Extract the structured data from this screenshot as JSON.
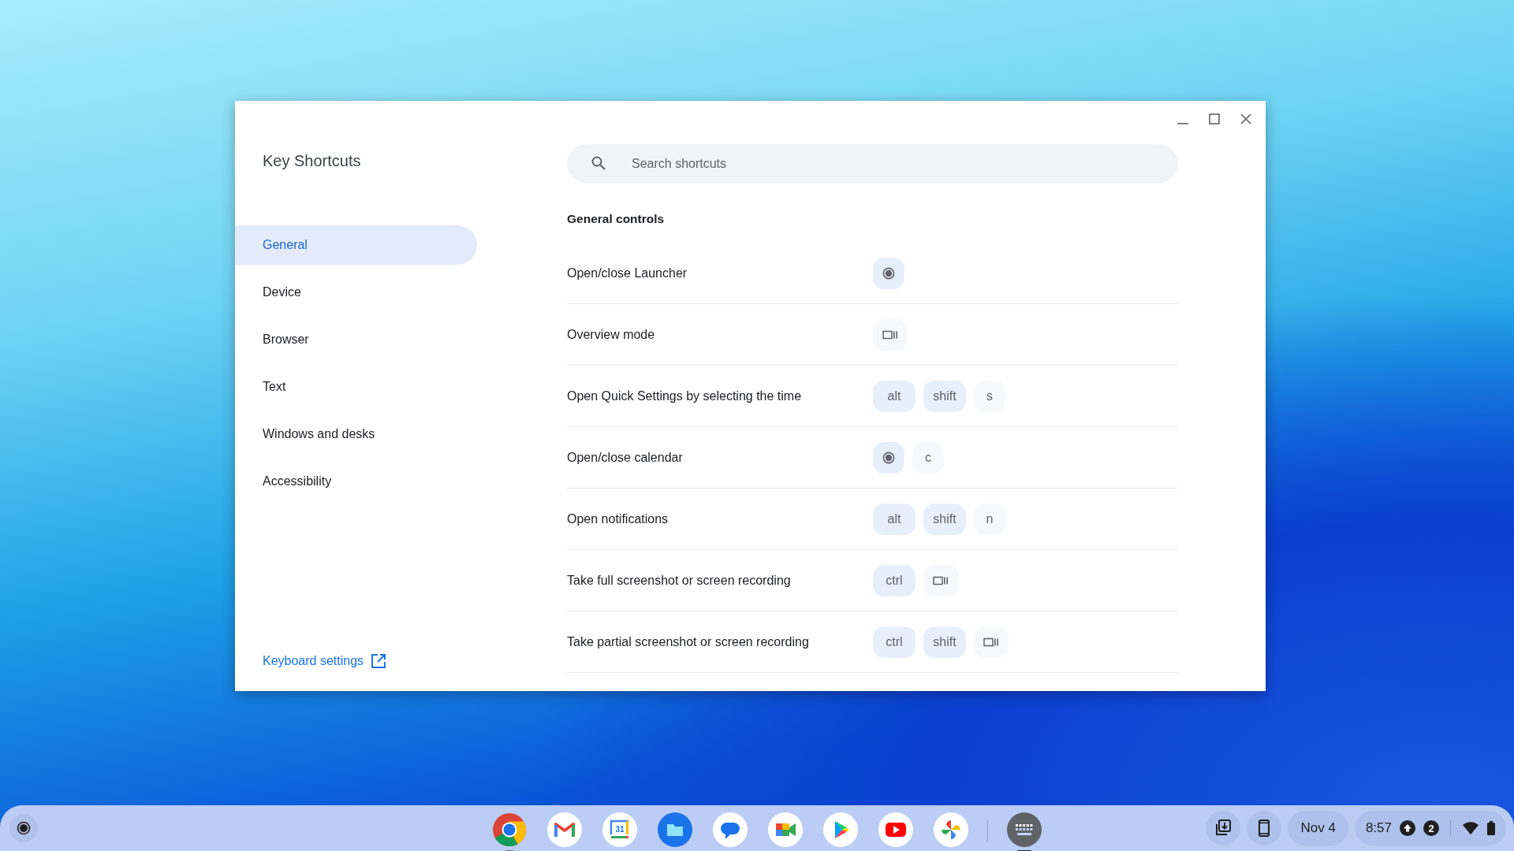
{
  "window": {
    "title": "Key Shortcuts"
  },
  "sidebar": {
    "items": [
      {
        "label": "General",
        "selected": true
      },
      {
        "label": "Device",
        "selected": false
      },
      {
        "label": "Browser",
        "selected": false
      },
      {
        "label": "Text",
        "selected": false
      },
      {
        "label": "Windows and desks",
        "selected": false
      },
      {
        "label": "Accessibility",
        "selected": false
      }
    ],
    "footer_link": "Keyboard settings"
  },
  "search": {
    "placeholder": "Search shortcuts"
  },
  "section_title": "General controls",
  "shortcuts": [
    {
      "description": "Open/close Launcher",
      "keys": [
        {
          "kind": "launcher"
        }
      ]
    },
    {
      "description": "Overview mode",
      "keys": [
        {
          "kind": "overview"
        }
      ]
    },
    {
      "description": "Open Quick Settings by selecting the time",
      "keys": [
        {
          "kind": "modifier",
          "label": "alt"
        },
        {
          "kind": "modifier",
          "label": "shift"
        },
        {
          "kind": "key",
          "label": "s"
        }
      ]
    },
    {
      "description": "Open/close calendar",
      "keys": [
        {
          "kind": "launcher"
        },
        {
          "kind": "key",
          "label": "c"
        }
      ]
    },
    {
      "description": "Open notifications",
      "keys": [
        {
          "kind": "modifier",
          "label": "alt"
        },
        {
          "kind": "modifier",
          "label": "shift"
        },
        {
          "kind": "key",
          "label": "n"
        }
      ]
    },
    {
      "description": "Take full screenshot or screen recording",
      "keys": [
        {
          "kind": "modifier",
          "label": "ctrl"
        },
        {
          "kind": "overview"
        }
      ]
    },
    {
      "description": "Take partial screenshot or screen recording",
      "keys": [
        {
          "kind": "modifier",
          "label": "ctrl"
        },
        {
          "kind": "modifier",
          "label": "shift"
        },
        {
          "kind": "overview"
        }
      ]
    }
  ],
  "shelf": {
    "apps": [
      {
        "kind": "chrome",
        "running": true,
        "focused": false
      },
      {
        "kind": "gmail",
        "running": false,
        "focused": false
      },
      {
        "kind": "calendar",
        "label": "31",
        "running": false,
        "focused": false
      },
      {
        "kind": "files",
        "running": false,
        "focused": false
      },
      {
        "kind": "messages",
        "running": false,
        "focused": false
      },
      {
        "kind": "meet",
        "running": false,
        "focused": false
      },
      {
        "kind": "play",
        "running": false,
        "focused": false
      },
      {
        "kind": "youtube",
        "running": false,
        "focused": false
      },
      {
        "kind": "photos",
        "running": false,
        "focused": false
      },
      {
        "kind": "shortcuts",
        "running": true,
        "focused": true
      }
    ],
    "date": "Nov 4",
    "time": "8:57",
    "notification_count": "2"
  }
}
